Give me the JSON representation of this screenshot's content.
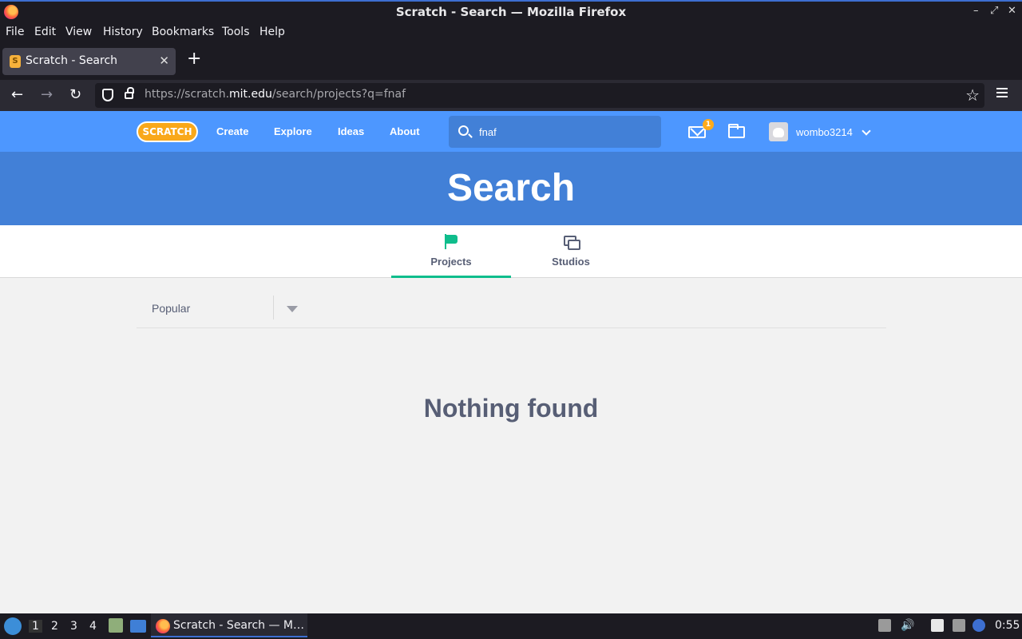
{
  "window": {
    "title": "Scratch - Search — Mozilla Firefox",
    "controls": [
      "–",
      "⤢",
      "✕"
    ]
  },
  "menu": [
    "File",
    "Edit",
    "View",
    "History",
    "Bookmarks",
    "Tools",
    "Help"
  ],
  "tab": {
    "title": "Scratch - Search",
    "favicon": "S",
    "close": "✕",
    "new_tab": "+"
  },
  "nav": {
    "back": "←",
    "forward": "→",
    "reload": "↻",
    "url_prefix": "https://scratch.",
    "url_domain": "mit.edu",
    "url_path": "/search/projects?q=fnaf",
    "star": "☆"
  },
  "scratch": {
    "logo": "SCRATCH",
    "links": [
      "Create",
      "Explore",
      "Ideas",
      "About"
    ],
    "search_value": "fnaf",
    "message_count": "1",
    "username": "wombo3214"
  },
  "banner_title": "Search",
  "tabs": [
    {
      "label": "Projects",
      "icon": "flag-icon",
      "active": true
    },
    {
      "label": "Studios",
      "icon": "studios-icon",
      "active": false
    }
  ],
  "filter": {
    "selected": "Popular"
  },
  "empty_message": "Nothing found",
  "taskbar": {
    "workspaces": [
      "1",
      "2",
      "3",
      "4"
    ],
    "task_label": "Scratch - Search — M…",
    "clock": "0:55"
  },
  "colors": {
    "scratch_blue": "#4d97ff",
    "banner_blue": "#4280d7",
    "accent_green": "#0fbd8c",
    "text_gray": "#575e75"
  }
}
